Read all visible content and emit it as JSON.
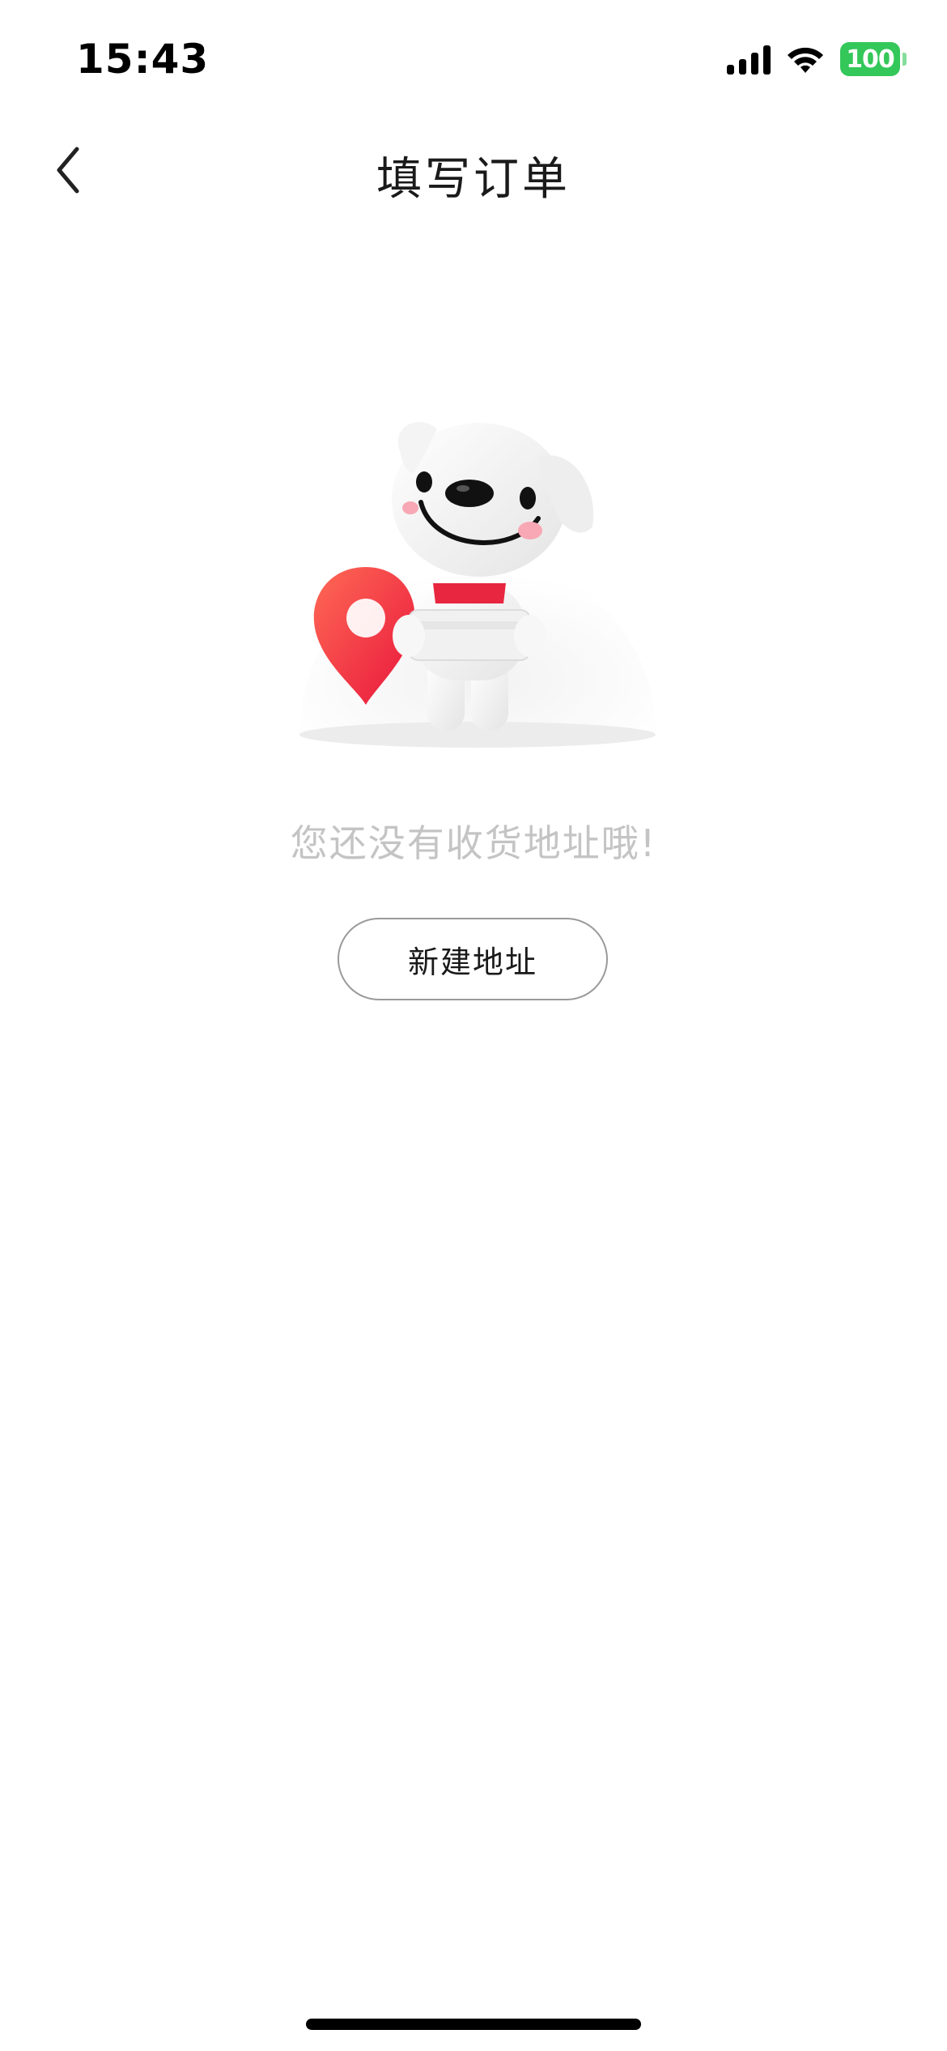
{
  "status_bar": {
    "time": "15:43",
    "battery_level": "100",
    "icons": [
      "signal-icon",
      "wifi-icon",
      "battery-icon"
    ],
    "battery_color": "#34c759"
  },
  "nav": {
    "back_icon": "chevron-left-icon",
    "title": "填写订单"
  },
  "empty_state": {
    "illustration": "dog-mascot-with-location-pin-illustration",
    "message": "您还没有收货地址哦!",
    "button_label": "新建地址"
  },
  "colors": {
    "pin_red": "#ff3b30",
    "text_muted": "#c4c4c4",
    "button_border": "#9a9a9a"
  }
}
